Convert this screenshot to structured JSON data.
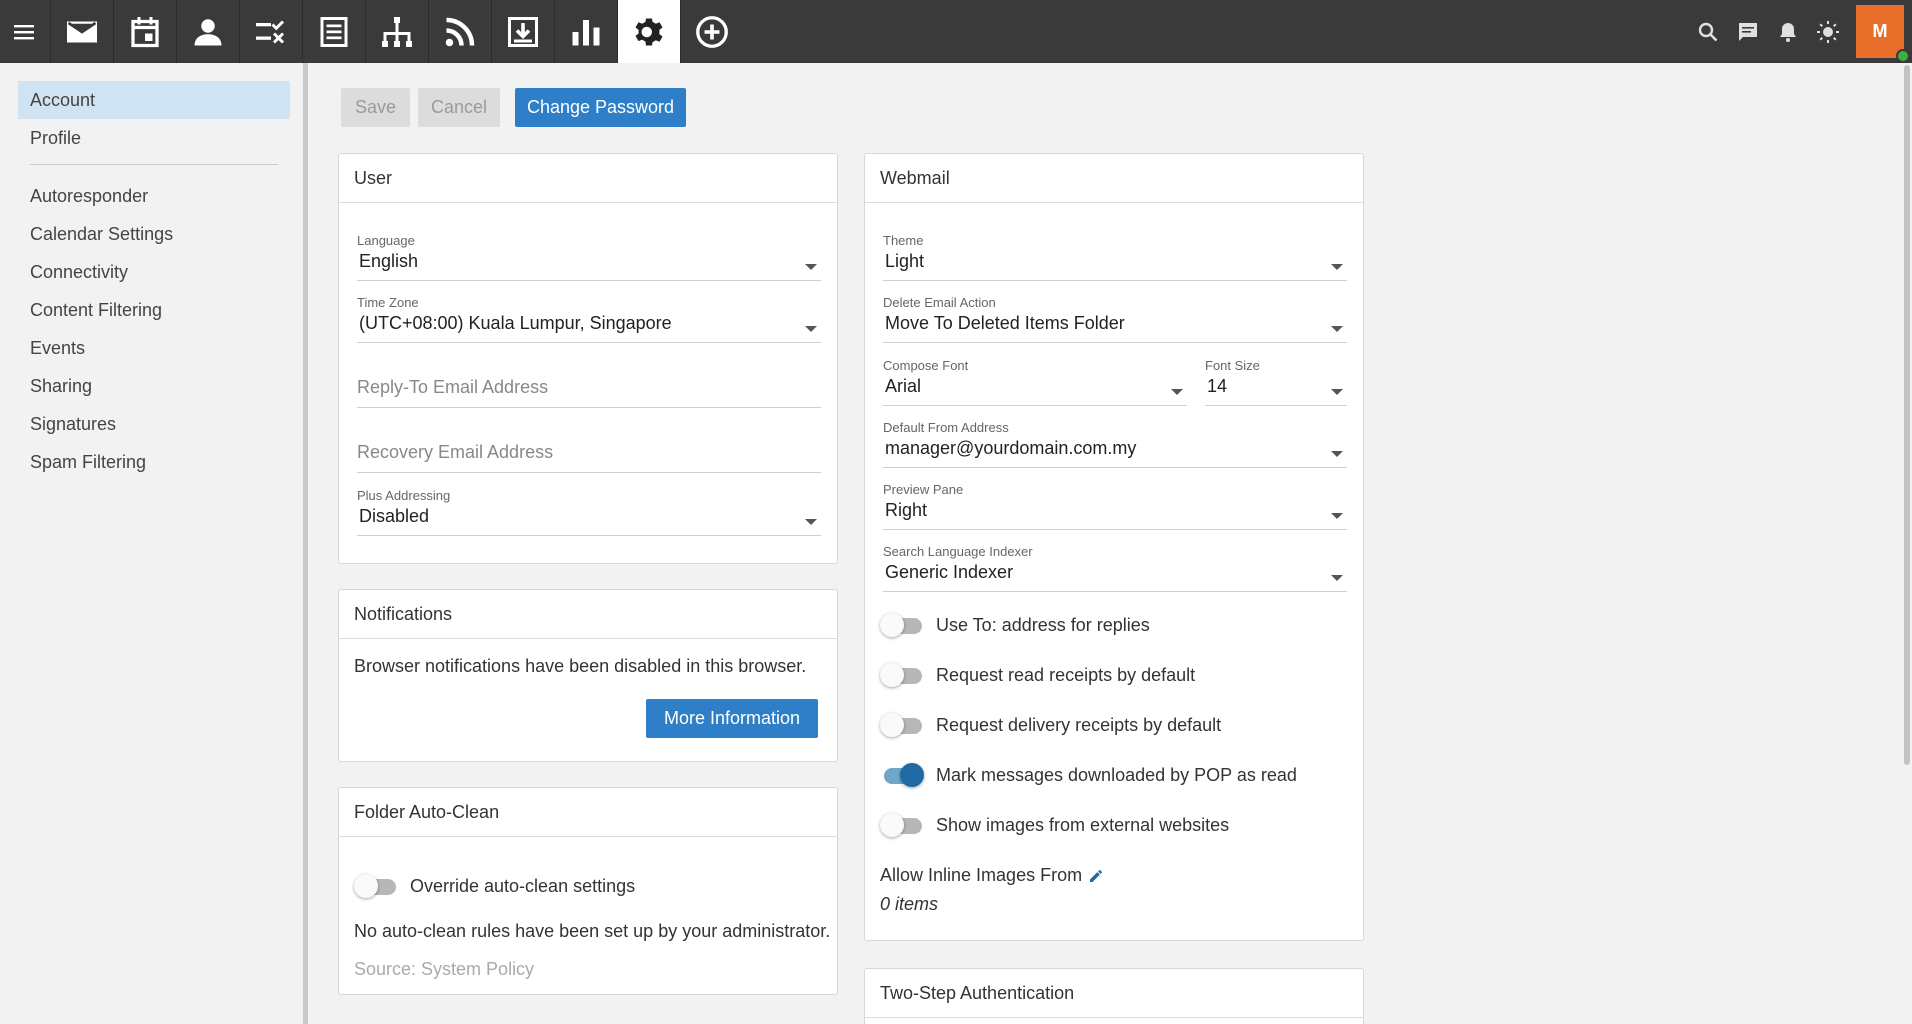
{
  "topbar": {
    "apps": [
      {
        "icon": "mail-icon"
      },
      {
        "icon": "calendar-icon"
      },
      {
        "icon": "contacts-icon"
      },
      {
        "icon": "tasks-icon"
      },
      {
        "icon": "notes-icon"
      },
      {
        "icon": "sitemap-icon"
      },
      {
        "icon": "rss-icon"
      },
      {
        "icon": "archive-download-icon"
      },
      {
        "icon": "reports-chart-icon"
      },
      {
        "icon": "settings-gear-icon",
        "active": true
      },
      {
        "icon": "add-circle-icon"
      }
    ],
    "avatar_initial": "M"
  },
  "sidebar": {
    "items": [
      {
        "label": "Account",
        "active": true
      },
      {
        "label": "Profile"
      },
      {
        "label": "Autoresponder"
      },
      {
        "label": "Calendar Settings"
      },
      {
        "label": "Connectivity"
      },
      {
        "label": "Content Filtering"
      },
      {
        "label": "Events"
      },
      {
        "label": "Sharing"
      },
      {
        "label": "Signatures"
      },
      {
        "label": "Spam Filtering"
      }
    ]
  },
  "toolbar": {
    "save_label": "Save",
    "cancel_label": "Cancel",
    "change_password_label": "Change Password"
  },
  "user_card": {
    "title": "User",
    "language_label": "Language",
    "language_value": "English",
    "timezone_label": "Time Zone",
    "timezone_value": "(UTC+08:00) Kuala Lumpur, Singapore",
    "reply_to_placeholder": "Reply-To Email Address",
    "recovery_placeholder": "Recovery Email Address",
    "plus_label": "Plus Addressing",
    "plus_value": "Disabled"
  },
  "notifications_card": {
    "title": "Notifications",
    "message": "Browser notifications have been disabled in this browser.",
    "more_info_label": "More Information"
  },
  "autoclean_card": {
    "title": "Folder Auto-Clean",
    "override_label": "Override auto-clean settings",
    "override_on": false,
    "message": "No auto-clean rules have been set up by your administrator.",
    "source": "Source: System Policy"
  },
  "webmail_card": {
    "title": "Webmail",
    "theme_label": "Theme",
    "theme_value": "Light",
    "delete_label": "Delete Email Action",
    "delete_value": "Move To Deleted Items Folder",
    "compose_font_label": "Compose Font",
    "compose_font_value": "Arial",
    "font_size_label": "Font Size",
    "font_size_value": "14",
    "from_label": "Default From Address",
    "from_value": "manager@yourdomain.com.my",
    "preview_label": "Preview Pane",
    "preview_value": "Right",
    "indexer_label": "Search Language Indexer",
    "indexer_value": "Generic Indexer",
    "toggles": [
      {
        "label": "Use To: address for replies",
        "on": false
      },
      {
        "label": "Request read receipts by default",
        "on": false
      },
      {
        "label": "Request delivery receipts by default",
        "on": false
      },
      {
        "label": "Mark messages downloaded by POP as read",
        "on": true
      },
      {
        "label": "Show images from external websites",
        "on": false
      }
    ],
    "inline_images_label": "Allow Inline Images From",
    "inline_images_count": "0 items"
  },
  "twostep_card": {
    "title": "Two-Step Authentication"
  },
  "colors": {
    "topbar": "#3a3a3a",
    "accent": "#2e7fc7",
    "avatar": "#e8702a",
    "sidebar_active": "#cfe3f3",
    "toggle_on": "#1f6aa5"
  }
}
